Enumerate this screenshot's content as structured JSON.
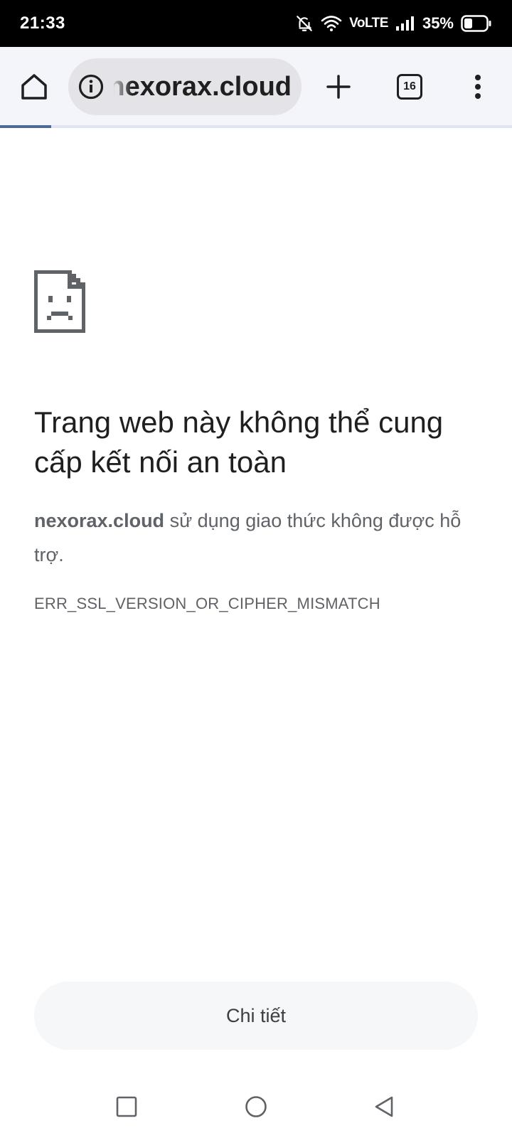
{
  "status_bar": {
    "time": "21:33",
    "network": "VoLTE",
    "battery": "35%",
    "icons": [
      "bell-off-icon",
      "wifi-icon",
      "signal-icon",
      "battery-icon"
    ]
  },
  "toolbar": {
    "url": "nexorax.cloud",
    "tab_count": "16",
    "load_progress": 0.1,
    "icons": [
      "home-icon",
      "info-icon",
      "plus-icon",
      "tabs-icon",
      "more-vert-icon"
    ]
  },
  "error": {
    "icon": "sad-page-icon",
    "title": "Trang web này không thể cung cấp kết nối an toàn",
    "site": "nexorax.cloud",
    "description": " sử dụng giao thức không được hỗ trợ.",
    "code": "ERR_SSL_VERSION_OR_CIPHER_MISMATCH"
  },
  "details_button": {
    "label": "Chi tiết"
  },
  "navigation": {
    "icons": [
      "recents-icon",
      "home-circle-icon",
      "back-icon"
    ]
  }
}
